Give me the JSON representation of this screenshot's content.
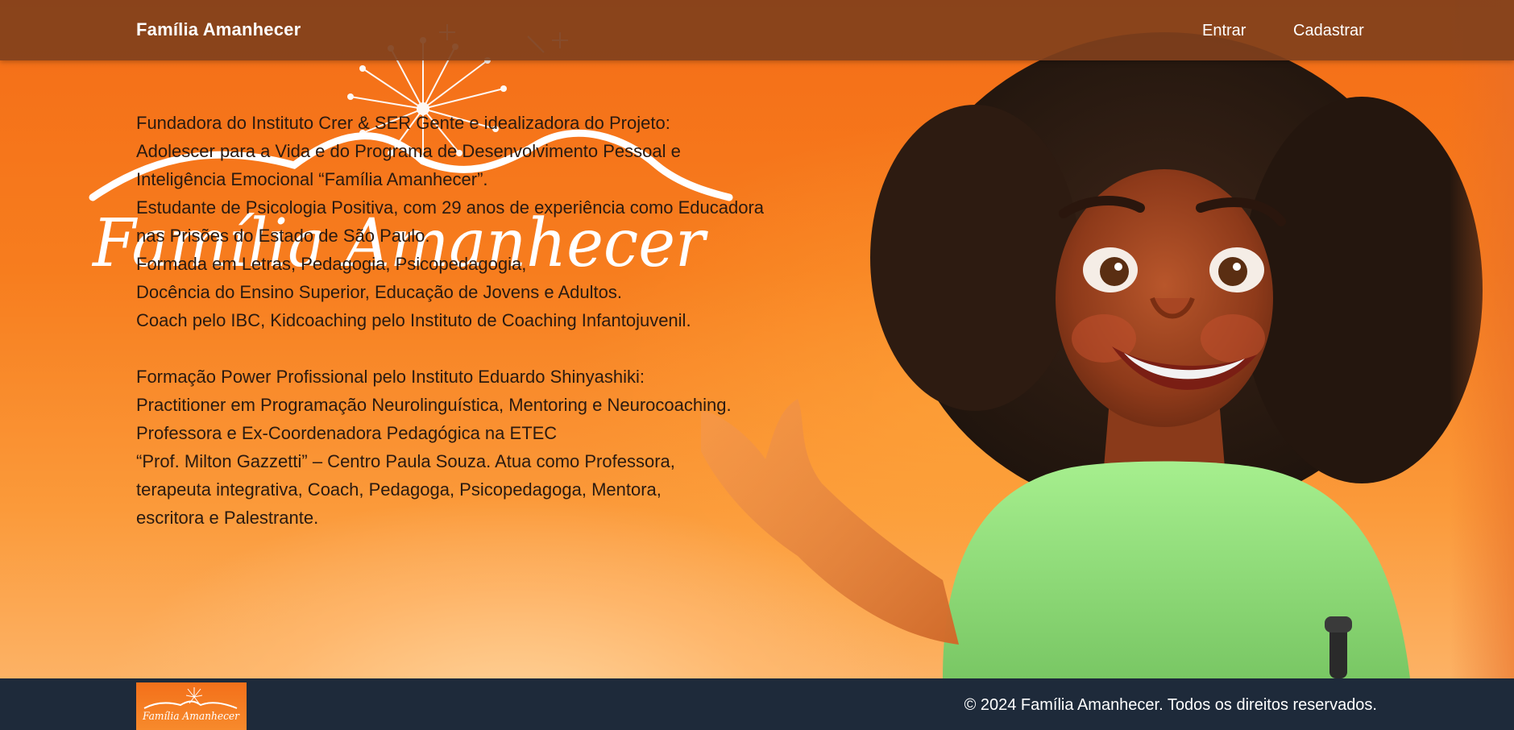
{
  "header": {
    "brand": "Família Amanhecer",
    "nav": [
      {
        "label": "Entrar"
      },
      {
        "label": "Cadastrar"
      }
    ]
  },
  "hero": {
    "watermark_text": "Família Amanhecer",
    "bio_paragraphs": [
      [
        "Fundadora do Instituto Crer & SER Gente e idealizadora do Projeto:",
        "Adolescer para a Vida e do Programa de Desenvolvimento Pessoal e",
        "Inteligência Emocional “Família Amanhecer”.",
        "Estudante de Psicologia Positiva, com 29 anos de experiência como Educadora",
        "nas Prisões do Estado de São Paulo.",
        "Formada em Letras, Pedagogia, Psicopedagogia,",
        "Docência do Ensino Superior, Educação de Jovens e Adultos.",
        "Coach pelo IBC, Kidcoaching pelo Instituto de Coaching Infantojuvenil."
      ],
      [
        "Formação Power Profissional pelo Instituto Eduardo Shinyashiki:",
        "Practitioner em Programação Neurolinguística, Mentoring e Neurocoaching.",
        "Professora e Ex-Coordenadora Pedagógica na ETEC",
        "“Prof. Milton Gazzetti” – Centro Paula Souza. Atua como Professora,",
        "terapeuta integrativa, Coach, Pedagoga, Psicopedagoga, Mentora,",
        "escritora e Palestrante."
      ]
    ]
  },
  "footer": {
    "logo_text": "Família Amanhecer",
    "copyright": "© 2024 Família Amanhecer. Todos os direitos reservados."
  },
  "colors": {
    "header_bg": "#80401c",
    "hero_orange": "#f46d17",
    "footer_bg": "#1e2a3a",
    "shirt_green": "#8fe07a"
  }
}
